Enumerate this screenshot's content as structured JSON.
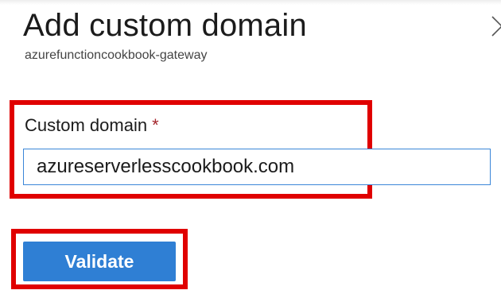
{
  "panel": {
    "title": "Add custom domain",
    "subtitle": "azurefunctioncookbook-gateway"
  },
  "form": {
    "custom_domain": {
      "label": "Custom domain",
      "required_marker": "*",
      "value": "azureserverlesscookbook.com"
    }
  },
  "actions": {
    "validate_label": "Validate"
  },
  "colors": {
    "accent": "#2f7fd4",
    "highlight_border": "#e00000",
    "required": "#a4262c"
  },
  "icons": {
    "close": "close-icon"
  }
}
